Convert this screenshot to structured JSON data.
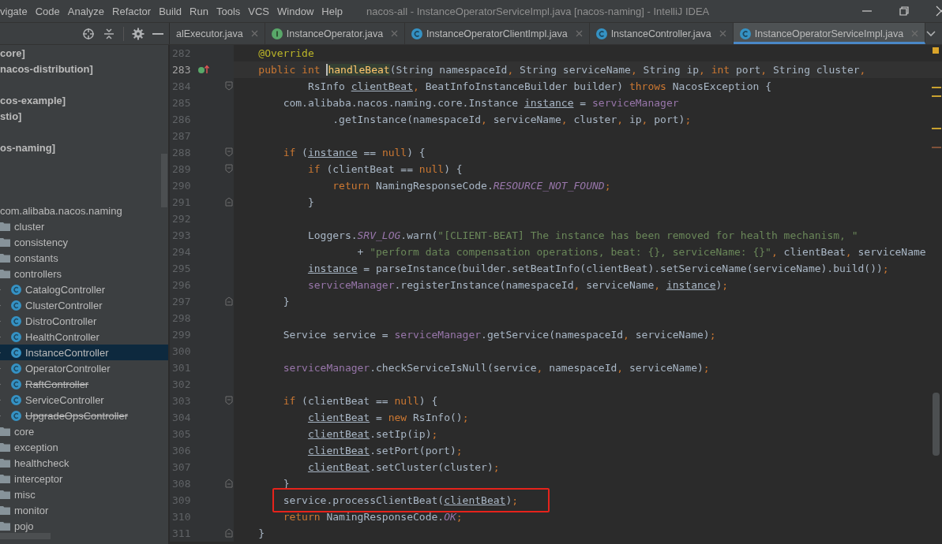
{
  "menu": [
    "vigate",
    "Code",
    "Analyze",
    "Refactor",
    "Build",
    "Run",
    "Tools",
    "VCS",
    "Window",
    "Help"
  ],
  "window": {
    "title": "nacos-all - InstanceOperatorServiceImpl.java [nacos-naming] - IntelliJ IDEA"
  },
  "tabs": [
    {
      "label": "alExecutor.java",
      "kind": "plain",
      "selected": false
    },
    {
      "label": "InstanceOperator.java",
      "kind": "interface",
      "selected": false
    },
    {
      "label": "InstanceOperatorClientImpl.java",
      "kind": "class",
      "selected": false
    },
    {
      "label": "InstanceController.java",
      "kind": "class",
      "selected": false
    },
    {
      "label": "InstanceOperatorServiceImpl.java",
      "kind": "class",
      "selected": true
    }
  ],
  "project_tree": [
    {
      "kind": "module",
      "label": "core]",
      "selected": false
    },
    {
      "kind": "module",
      "label": "nacos-distribution]",
      "selected": false
    },
    {
      "kind": "blank"
    },
    {
      "kind": "module",
      "label": "cos-example]",
      "selected": false
    },
    {
      "kind": "module",
      "label": "stio]",
      "selected": false
    },
    {
      "kind": "blank"
    },
    {
      "kind": "module",
      "label": "os-naming]",
      "selected": false
    },
    {
      "kind": "blank"
    },
    {
      "kind": "blank"
    },
    {
      "kind": "blank"
    },
    {
      "kind": "package",
      "label": "com.alibaba.nacos.naming",
      "selected": false,
      "children": [
        {
          "kind": "folder",
          "label": "cluster",
          "selected": false
        },
        {
          "kind": "folder",
          "label": "consistency",
          "selected": false
        },
        {
          "kind": "folder",
          "label": "constants",
          "selected": false
        },
        {
          "kind": "folder",
          "label": "controllers",
          "selected": false,
          "children": [
            {
              "kind": "class",
              "label": "CatalogController",
              "selected": false,
              "deprecated": false
            },
            {
              "kind": "class",
              "label": "ClusterController",
              "selected": false,
              "deprecated": false
            },
            {
              "kind": "class",
              "label": "DistroController",
              "selected": false,
              "deprecated": false
            },
            {
              "kind": "class",
              "label": "HealthController",
              "selected": false,
              "deprecated": false
            },
            {
              "kind": "class",
              "label": "InstanceController",
              "selected": true,
              "deprecated": false
            },
            {
              "kind": "class",
              "label": "OperatorController",
              "selected": false,
              "deprecated": false
            },
            {
              "kind": "class",
              "label": "RaftController",
              "selected": false,
              "deprecated": true
            },
            {
              "kind": "class",
              "label": "ServiceController",
              "selected": false,
              "deprecated": false
            },
            {
              "kind": "class",
              "label": "UpgradeOpsController",
              "selected": false,
              "deprecated": true
            }
          ]
        },
        {
          "kind": "folder",
          "label": "core",
          "selected": false
        },
        {
          "kind": "folder",
          "label": "exception",
          "selected": false
        },
        {
          "kind": "folder",
          "label": "healthcheck",
          "selected": false
        },
        {
          "kind": "folder",
          "label": "interceptor",
          "selected": false
        },
        {
          "kind": "folder",
          "label": "misc",
          "selected": false
        },
        {
          "kind": "folder",
          "label": "monitor",
          "selected": false
        },
        {
          "kind": "folder",
          "label": "pojo",
          "selected": false
        }
      ]
    }
  ],
  "code_lines": [
    {
      "number": "282",
      "tokens": [
        {
          "text": "    @Override",
          "kind": "annotation"
        }
      ]
    },
    {
      "number": "283",
      "current": true,
      "implements_marker": true,
      "tokens": [
        {
          "text": "    public int ",
          "kind": "keyword"
        },
        {
          "text": "handleBeat",
          "kind": "declaration"
        },
        {
          "text": "(String namespaceId, String serviceName, String ip, "
        },
        {
          "text": "int",
          "kind": "keyword"
        },
        {
          "text": " port, String cluster,"
        }
      ]
    },
    {
      "number": "284",
      "fold_start": true,
      "tokens": [
        {
          "text": "            RsInfo "
        },
        {
          "text": "clientBeat",
          "kind": "local"
        },
        {
          "text": ", BeatInfoInstanceBuilder builder) "
        },
        {
          "text": "throws",
          "kind": "keyword"
        },
        {
          "text": " NacosException {"
        }
      ]
    },
    {
      "number": "285",
      "tokens": [
        {
          "text": "        com.alibaba.nacos.naming.core.Instance "
        },
        {
          "text": "instance",
          "kind": "local"
        },
        {
          "text": " = "
        },
        {
          "text": "serviceManager",
          "kind": "member"
        }
      ]
    },
    {
      "number": "286",
      "tokens": [
        {
          "text": "                .getInstance(namespaceId, serviceName, cluster, ip, port);"
        }
      ]
    },
    {
      "number": "287"
    },
    {
      "number": "288",
      "fold_start": true,
      "tokens": [
        {
          "text": "        if",
          "kind": "keyword"
        },
        {
          "text": " ("
        },
        {
          "text": "instance",
          "kind": "local"
        },
        {
          "text": " == "
        },
        {
          "text": "null",
          "kind": "keyword"
        },
        {
          "text": ") {"
        }
      ]
    },
    {
      "number": "289",
      "fold_start": true,
      "tokens": [
        {
          "text": "            if",
          "kind": "keyword"
        },
        {
          "text": " (clientBeat == "
        },
        {
          "text": "null",
          "kind": "keyword"
        },
        {
          "text": ") {"
        }
      ]
    },
    {
      "number": "290",
      "tokens": [
        {
          "text": "                return",
          "kind": "keyword"
        },
        {
          "text": " NamingResponseCode."
        },
        {
          "text": "RESOURCE_NOT_FOUND",
          "kind": "constant"
        },
        {
          "text": ";"
        }
      ]
    },
    {
      "number": "291",
      "fold_end": true,
      "tokens": [
        {
          "text": "            }"
        }
      ]
    },
    {
      "number": "292"
    },
    {
      "number": "293",
      "tokens": [
        {
          "text": "            Loggers."
        },
        {
          "text": "SRV_LOG",
          "kind": "constant"
        },
        {
          "text": ".warn("
        },
        {
          "text": "\"[CLIENT-BEAT] The instance has been removed for health mechanism, \"",
          "kind": "string"
        }
      ]
    },
    {
      "number": "294",
      "tokens": [
        {
          "text": "                    + "
        },
        {
          "text": "\"perform data compensation operations, beat: {}, serviceName: {}\"",
          "kind": "string"
        },
        {
          "text": ", clientBeat, serviceName"
        }
      ]
    },
    {
      "number": "295",
      "tokens": [
        {
          "text": "            instance",
          "kind": "local"
        },
        {
          "text": " = parseInstance(builder.setBeatInfo(clientBeat).setServiceName(serviceName).build());"
        }
      ]
    },
    {
      "number": "296",
      "tokens": [
        {
          "text": "            serviceManager",
          "kind": "member"
        },
        {
          "text": ".registerInstance(namespaceId, serviceName, "
        },
        {
          "text": "instance",
          "kind": "local"
        },
        {
          "text": ");"
        }
      ]
    },
    {
      "number": "297",
      "fold_end": true,
      "tokens": [
        {
          "text": "        }"
        }
      ]
    },
    {
      "number": "298"
    },
    {
      "number": "299",
      "tokens": [
        {
          "text": "        Service service = "
        },
        {
          "text": "serviceManager",
          "kind": "member"
        },
        {
          "text": ".getService(namespaceId, serviceName);"
        }
      ]
    },
    {
      "number": "300"
    },
    {
      "number": "301",
      "tokens": [
        {
          "text": "        serviceManager",
          "kind": "member"
        },
        {
          "text": ".checkServiceIsNull(service, namespaceId, serviceName);"
        }
      ]
    },
    {
      "number": "302"
    },
    {
      "number": "303",
      "fold_start": true,
      "tokens": [
        {
          "text": "        if",
          "kind": "keyword"
        },
        {
          "text": " (clientBeat == "
        },
        {
          "text": "null",
          "kind": "keyword"
        },
        {
          "text": ") {"
        }
      ]
    },
    {
      "number": "304",
      "tokens": [
        {
          "text": "            clientBeat",
          "kind": "local"
        },
        {
          "text": " = "
        },
        {
          "text": "new",
          "kind": "keyword"
        },
        {
          "text": " RsInfo();"
        }
      ]
    },
    {
      "number": "305",
      "tokens": [
        {
          "text": "            clientBeat",
          "kind": "local"
        },
        {
          "text": ".setIp(ip);"
        }
      ]
    },
    {
      "number": "306",
      "tokens": [
        {
          "text": "            clientBeat",
          "kind": "local"
        },
        {
          "text": ".setPort(port);"
        }
      ]
    },
    {
      "number": "307",
      "tokens": [
        {
          "text": "            clientBeat",
          "kind": "local"
        },
        {
          "text": ".setCluster(cluster);"
        }
      ]
    },
    {
      "number": "308",
      "fold_end": true,
      "tokens": [
        {
          "text": "        }"
        }
      ]
    },
    {
      "number": "309",
      "boxed": true,
      "tokens": [
        {
          "text": "        service.processClientBeat("
        },
        {
          "text": "clientBeat",
          "kind": "local"
        },
        {
          "text": ");"
        }
      ]
    },
    {
      "number": "310",
      "tokens": [
        {
          "text": "        return",
          "kind": "keyword"
        },
        {
          "text": " NamingResponseCode."
        },
        {
          "text": "OK",
          "kind": "constant"
        },
        {
          "text": ";"
        }
      ]
    },
    {
      "number": "311",
      "fold_end": true,
      "tokens": [
        {
          "text": "    }"
        }
      ]
    }
  ]
}
